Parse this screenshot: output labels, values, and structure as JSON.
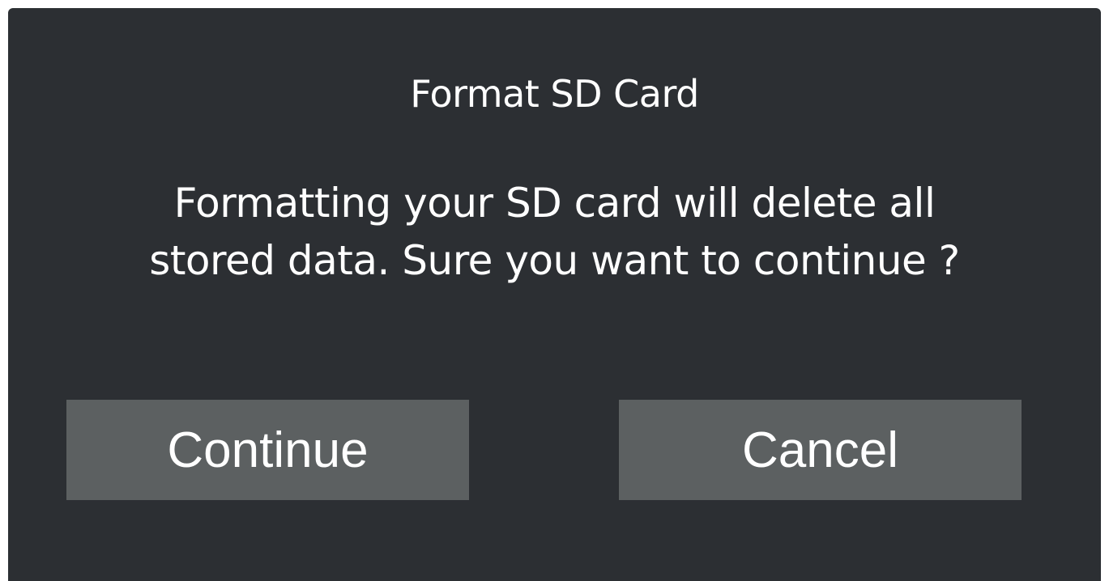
{
  "dialog": {
    "title": "Format SD Card",
    "message": "Formatting your SD card will delete all stored data. Sure you want to continue ?",
    "continue_label": "Continue",
    "cancel_label": "Cancel"
  },
  "colors": {
    "dialog_background": "#2c2f33",
    "button_background": "#5c6061",
    "text": "#ffffff"
  }
}
